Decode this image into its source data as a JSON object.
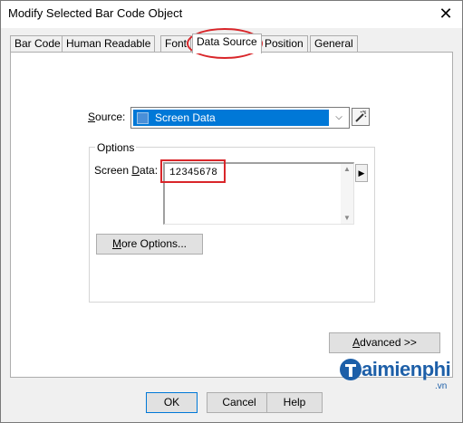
{
  "window": {
    "title": "Modify Selected Bar Code Object",
    "close": "✕"
  },
  "tabs": [
    {
      "label": "Bar Code",
      "active": false
    },
    {
      "label": "Human Readable",
      "active": false
    },
    {
      "label": "Font",
      "active": false
    },
    {
      "label": "Data Source",
      "active": true
    },
    {
      "label": "Position",
      "active": false
    },
    {
      "label": "General",
      "active": false
    }
  ],
  "source": {
    "label_pre": "S",
    "label_post": "ource:",
    "value": "Screen Data",
    "arrow": "⌵",
    "wand": "wand-icon"
  },
  "options": {
    "group_label": "Options",
    "screen_data_label_pre": "Screen ",
    "screen_data_label_u": "D",
    "screen_data_label_post": "ata:",
    "screen_data_value": "12345678",
    "more_options_pre": "M",
    "more_options_post": "ore Options...",
    "expand_arrow": "▶"
  },
  "buttons": {
    "advanced_pre": "A",
    "advanced_post": "dvanced >>",
    "ok": "OK",
    "cancel": "Cancel",
    "help": "Help"
  },
  "watermark": {
    "brand": "aimienphi",
    "sub": ".vn"
  },
  "colors": {
    "highlight_red": "#d9262a",
    "selection_blue": "#0078d7",
    "brand_blue": "#1d5fa8"
  }
}
